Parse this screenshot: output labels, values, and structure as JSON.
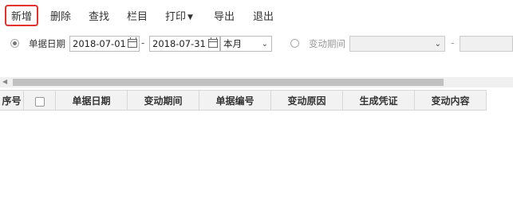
{
  "toolbar": {
    "add": "新增",
    "delete": "删除",
    "find": "查找",
    "columns": "栏目",
    "print": "打印",
    "export": "导出",
    "exit": "退出"
  },
  "filter": {
    "bill_date_label": "单据日期",
    "date_from": "2018-07-01",
    "date_sep": "-",
    "date_to": "2018-07-31",
    "range_select": "本月",
    "period_label": "变动期间",
    "period_from": "",
    "period_sep": "-",
    "period_to": ""
  },
  "table": {
    "columns": [
      "序号",
      "",
      "单据日期",
      "变动期间",
      "单据编号",
      "变动原因",
      "生成凭证",
      "变动内容"
    ]
  },
  "colors": {
    "highlight": "#e5322d",
    "header_bg": "#f2f2f2",
    "scroll_thumb": "#c1c1c1"
  }
}
